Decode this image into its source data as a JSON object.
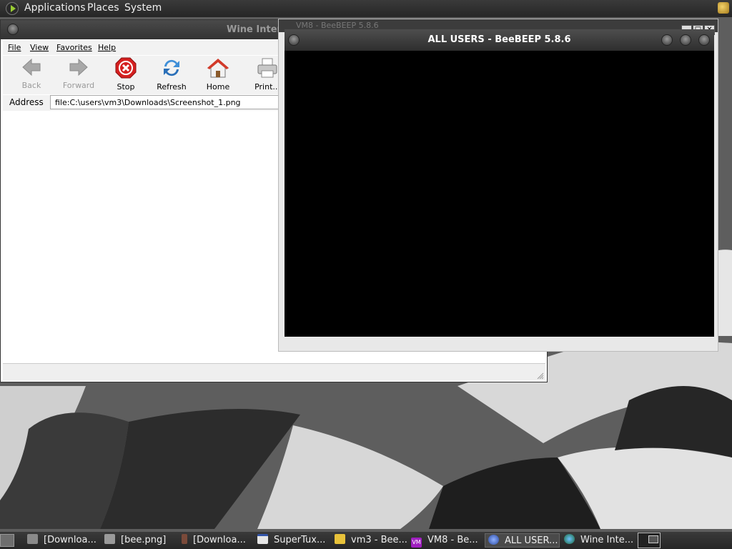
{
  "top_panel": {
    "menus": [
      "Applications",
      "Places",
      "System"
    ]
  },
  "wine_window": {
    "title": "Wine Intern",
    "menu": [
      "File",
      "View",
      "Favorites",
      "Help"
    ],
    "toolbar": {
      "back": "Back",
      "forward": "Forward",
      "stop": "Stop",
      "refresh": "Refresh",
      "home": "Home",
      "print": "Print..."
    },
    "address_label": "Address",
    "address_value": "file:C:\\users\\vm3\\Downloads\\Screenshot_1.png"
  },
  "bee_window": {
    "back_title": "VM8 - BeeBEEP 5.8.6",
    "title": "ALL USERS - BeeBEEP 5.8.6"
  },
  "taskbar": {
    "tasks": [
      {
        "label": "[Downloa...",
        "icon": "folder-icon"
      },
      {
        "label": "[bee.png]",
        "icon": "image-icon"
      },
      {
        "label": "[Downloa...",
        "icon": "download-icon"
      },
      {
        "label": "SuperTux...",
        "icon": "window-icon"
      },
      {
        "label": "vm3 - Bee...",
        "icon": "bee-icon"
      },
      {
        "label": "VM8 - Be...",
        "icon": "vm-icon"
      },
      {
        "label": "ALL USER...",
        "icon": "beebeep-icon"
      },
      {
        "label": "Wine Inte...",
        "icon": "ie-icon"
      }
    ]
  },
  "colors": {
    "panel": "#2f2f2f",
    "window_title_bg": "#3a3a3a",
    "bee_body": "#000000",
    "stop_red": "#d52020"
  }
}
